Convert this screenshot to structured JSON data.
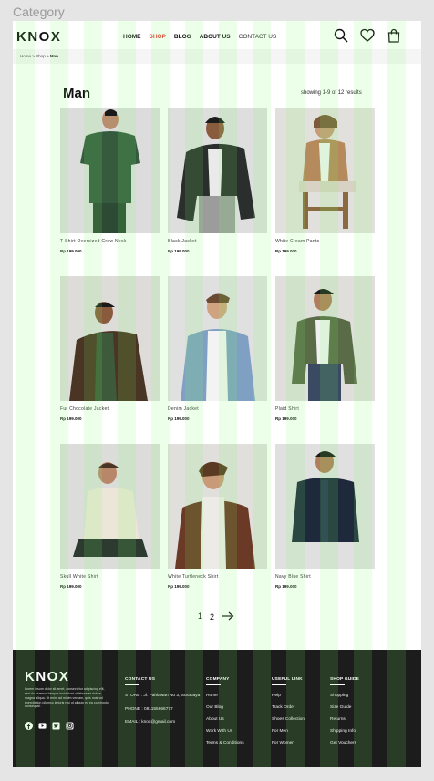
{
  "canvas_label": "Category",
  "header": {
    "logo": "KNOX",
    "nav": [
      "HOME",
      "SHOP",
      "BLOG",
      "ABOUT US",
      "CONTACT US"
    ],
    "icons": [
      "search-icon",
      "heart-icon",
      "bag-icon"
    ]
  },
  "breadcrumb": {
    "items": [
      "Home",
      "Shop"
    ],
    "current": "Man",
    "separator": ">"
  },
  "page": {
    "title": "Man",
    "results": "showing 1-9 of 12 results"
  },
  "products": [
    {
      "name": "T-Shirt Oversized Crew Neck",
      "price": "Rp 199.000"
    },
    {
      "name": "Black Jacket",
      "price": "Rp 199.000"
    },
    {
      "name": "White Cream Pants",
      "price": "Rp 199.000"
    },
    {
      "name": "Fur Chocolate Jacket",
      "price": "Rp 199.000"
    },
    {
      "name": "Denim Jacket",
      "price": "Rp 199.000"
    },
    {
      "name": "Plaid Shirt",
      "price": "Rp 199.000"
    },
    {
      "name": "Skull White Shirt",
      "price": "Rp 199.000"
    },
    {
      "name": "White Turtleneck Shirt",
      "price": "Rp 199.000"
    },
    {
      "name": "Navy Blue Shirt",
      "price": "Rp 199.000"
    }
  ],
  "pagination": {
    "pages": [
      "1",
      "2"
    ],
    "current": "1"
  },
  "footer": {
    "logo": "KNOX",
    "description": "Lorem ipsum dolor sit amet, consectetur adipiscing elit, sed do eiusmod tempor incididunt ut labore et dolore magna aliqua. Ut enim ad minim veniam, quis nostrud exercitation ullamco laboris nisi ut aliquip ex ea commodo consequat.",
    "social": [
      "facebook-icon",
      "youtube-icon",
      "twitter-icon",
      "instagram-icon"
    ],
    "contact": {
      "heading": "CONTACT US",
      "store": "STORE : Jl. Pahlawan No 3, Surabaya",
      "phone": "PHONE : 081155666777",
      "email": "EMAIL : knox@gmail.com"
    },
    "company": {
      "heading": "COMPANY",
      "items": [
        "Home",
        "Our Blog",
        "About Us",
        "Work With Us",
        "Terms & Conditions"
      ]
    },
    "useful": {
      "heading": "USEFUL LINK",
      "items": [
        "Help",
        "Track Order",
        "Shoes Collection",
        "For Men",
        "For Women"
      ]
    },
    "shop": {
      "heading": "SHOP GUIDE",
      "items": [
        "Shopping",
        "Size Guide",
        "Returns",
        "Shipping Info",
        "Get Vouchers"
      ]
    }
  },
  "colors": {
    "accent": "#e23b3b",
    "footer_bg": "#1c1c1c",
    "grid_overlay": "#78ff64"
  }
}
